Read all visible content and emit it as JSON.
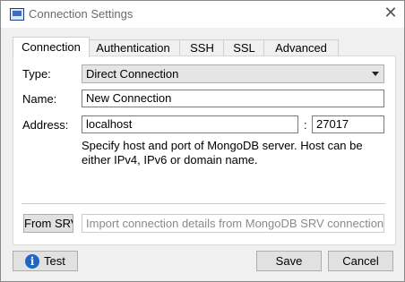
{
  "window": {
    "title": "Connection Settings"
  },
  "tabs": [
    {
      "label": "Connection",
      "active": true
    },
    {
      "label": "Authentication",
      "active": false
    },
    {
      "label": "SSH",
      "active": false
    },
    {
      "label": "SSL",
      "active": false
    },
    {
      "label": "Advanced",
      "active": false
    }
  ],
  "connection": {
    "type_label": "Type:",
    "type_value": "Direct Connection",
    "name_label": "Name:",
    "name_value": "New Connection",
    "address_label": "Address:",
    "host_value": "localhost",
    "port_separator": ":",
    "port_value": "27017",
    "hint": "Specify host and port of MongoDB server. Host can be either IPv4, IPv6 or domain name.",
    "srv_button_label": "From SRV",
    "srv_placeholder": "Import connection details from MongoDB SRV connection string"
  },
  "footer": {
    "test_label": "Test",
    "save_label": "Save",
    "cancel_label": "Cancel"
  },
  "colors": {
    "info_icon": "#1d64c4"
  },
  "icons": {
    "close": "close-icon",
    "info": "info-icon",
    "app": "app-icon",
    "dropdown": "chevron-down-icon"
  }
}
